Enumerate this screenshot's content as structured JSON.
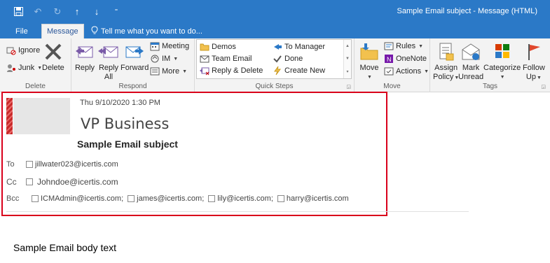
{
  "window": {
    "title": "Sample Email subject  -  Message (HTML)"
  },
  "quick_access": {
    "save_icon": "save-icon",
    "undo_icon": "undo-icon",
    "redo_icon": "redo-icon",
    "up_icon": "up-arrow-icon",
    "down_icon": "down-arrow-icon",
    "customize_icon": "customize-icon"
  },
  "tabs": {
    "file": "File",
    "message": "Message",
    "tell_me": "Tell me what you want to do..."
  },
  "ribbon": {
    "delete_group": {
      "label": "Delete",
      "ignore": "Ignore",
      "junk": "Junk",
      "delete": "Delete"
    },
    "respond_group": {
      "label": "Respond",
      "reply": "Reply",
      "reply_all_line1": "Reply",
      "reply_all_line2": "All",
      "forward": "Forward",
      "meeting": "Meeting",
      "im": "IM",
      "more": "More"
    },
    "quick_steps_group": {
      "label": "Quick Steps",
      "items": [
        "Demos",
        "Team Email",
        "Reply & Delete",
        "To Manager",
        "Done",
        "Create New"
      ]
    },
    "move_group": {
      "label": "Move",
      "move": "Move",
      "rules": "Rules",
      "onenote": "OneNote",
      "actions": "Actions"
    },
    "tags_group": {
      "label": "Tags",
      "assign_policy_line1": "Assign",
      "assign_policy_line2": "Policy",
      "mark_unread_line1": "Mark",
      "mark_unread_line2": "Unread",
      "categorize": "Categorize",
      "follow_up_line1": "Follow",
      "follow_up_line2": "Up"
    }
  },
  "email": {
    "sent_date": "Thu 9/10/2020 1:30 PM",
    "sender": "VP Business",
    "subject": "Sample Email subject",
    "to_label": "To",
    "to": [
      "jillwater023@icertis.com"
    ],
    "cc_label": "Cc",
    "cc": [
      "Johndoe@icertis.com"
    ],
    "bcc_label": "Bcc",
    "bcc": [
      "ICMAdmin@icertis.com;",
      "james@icertis.com;",
      "lily@icertis.com;",
      "harry@icertis.com"
    ],
    "body": "Sample Email body text"
  },
  "colors": {
    "titlebar": "#2b79c7",
    "highlight_border": "#d9001b",
    "category_bar": "#c92a2a"
  }
}
